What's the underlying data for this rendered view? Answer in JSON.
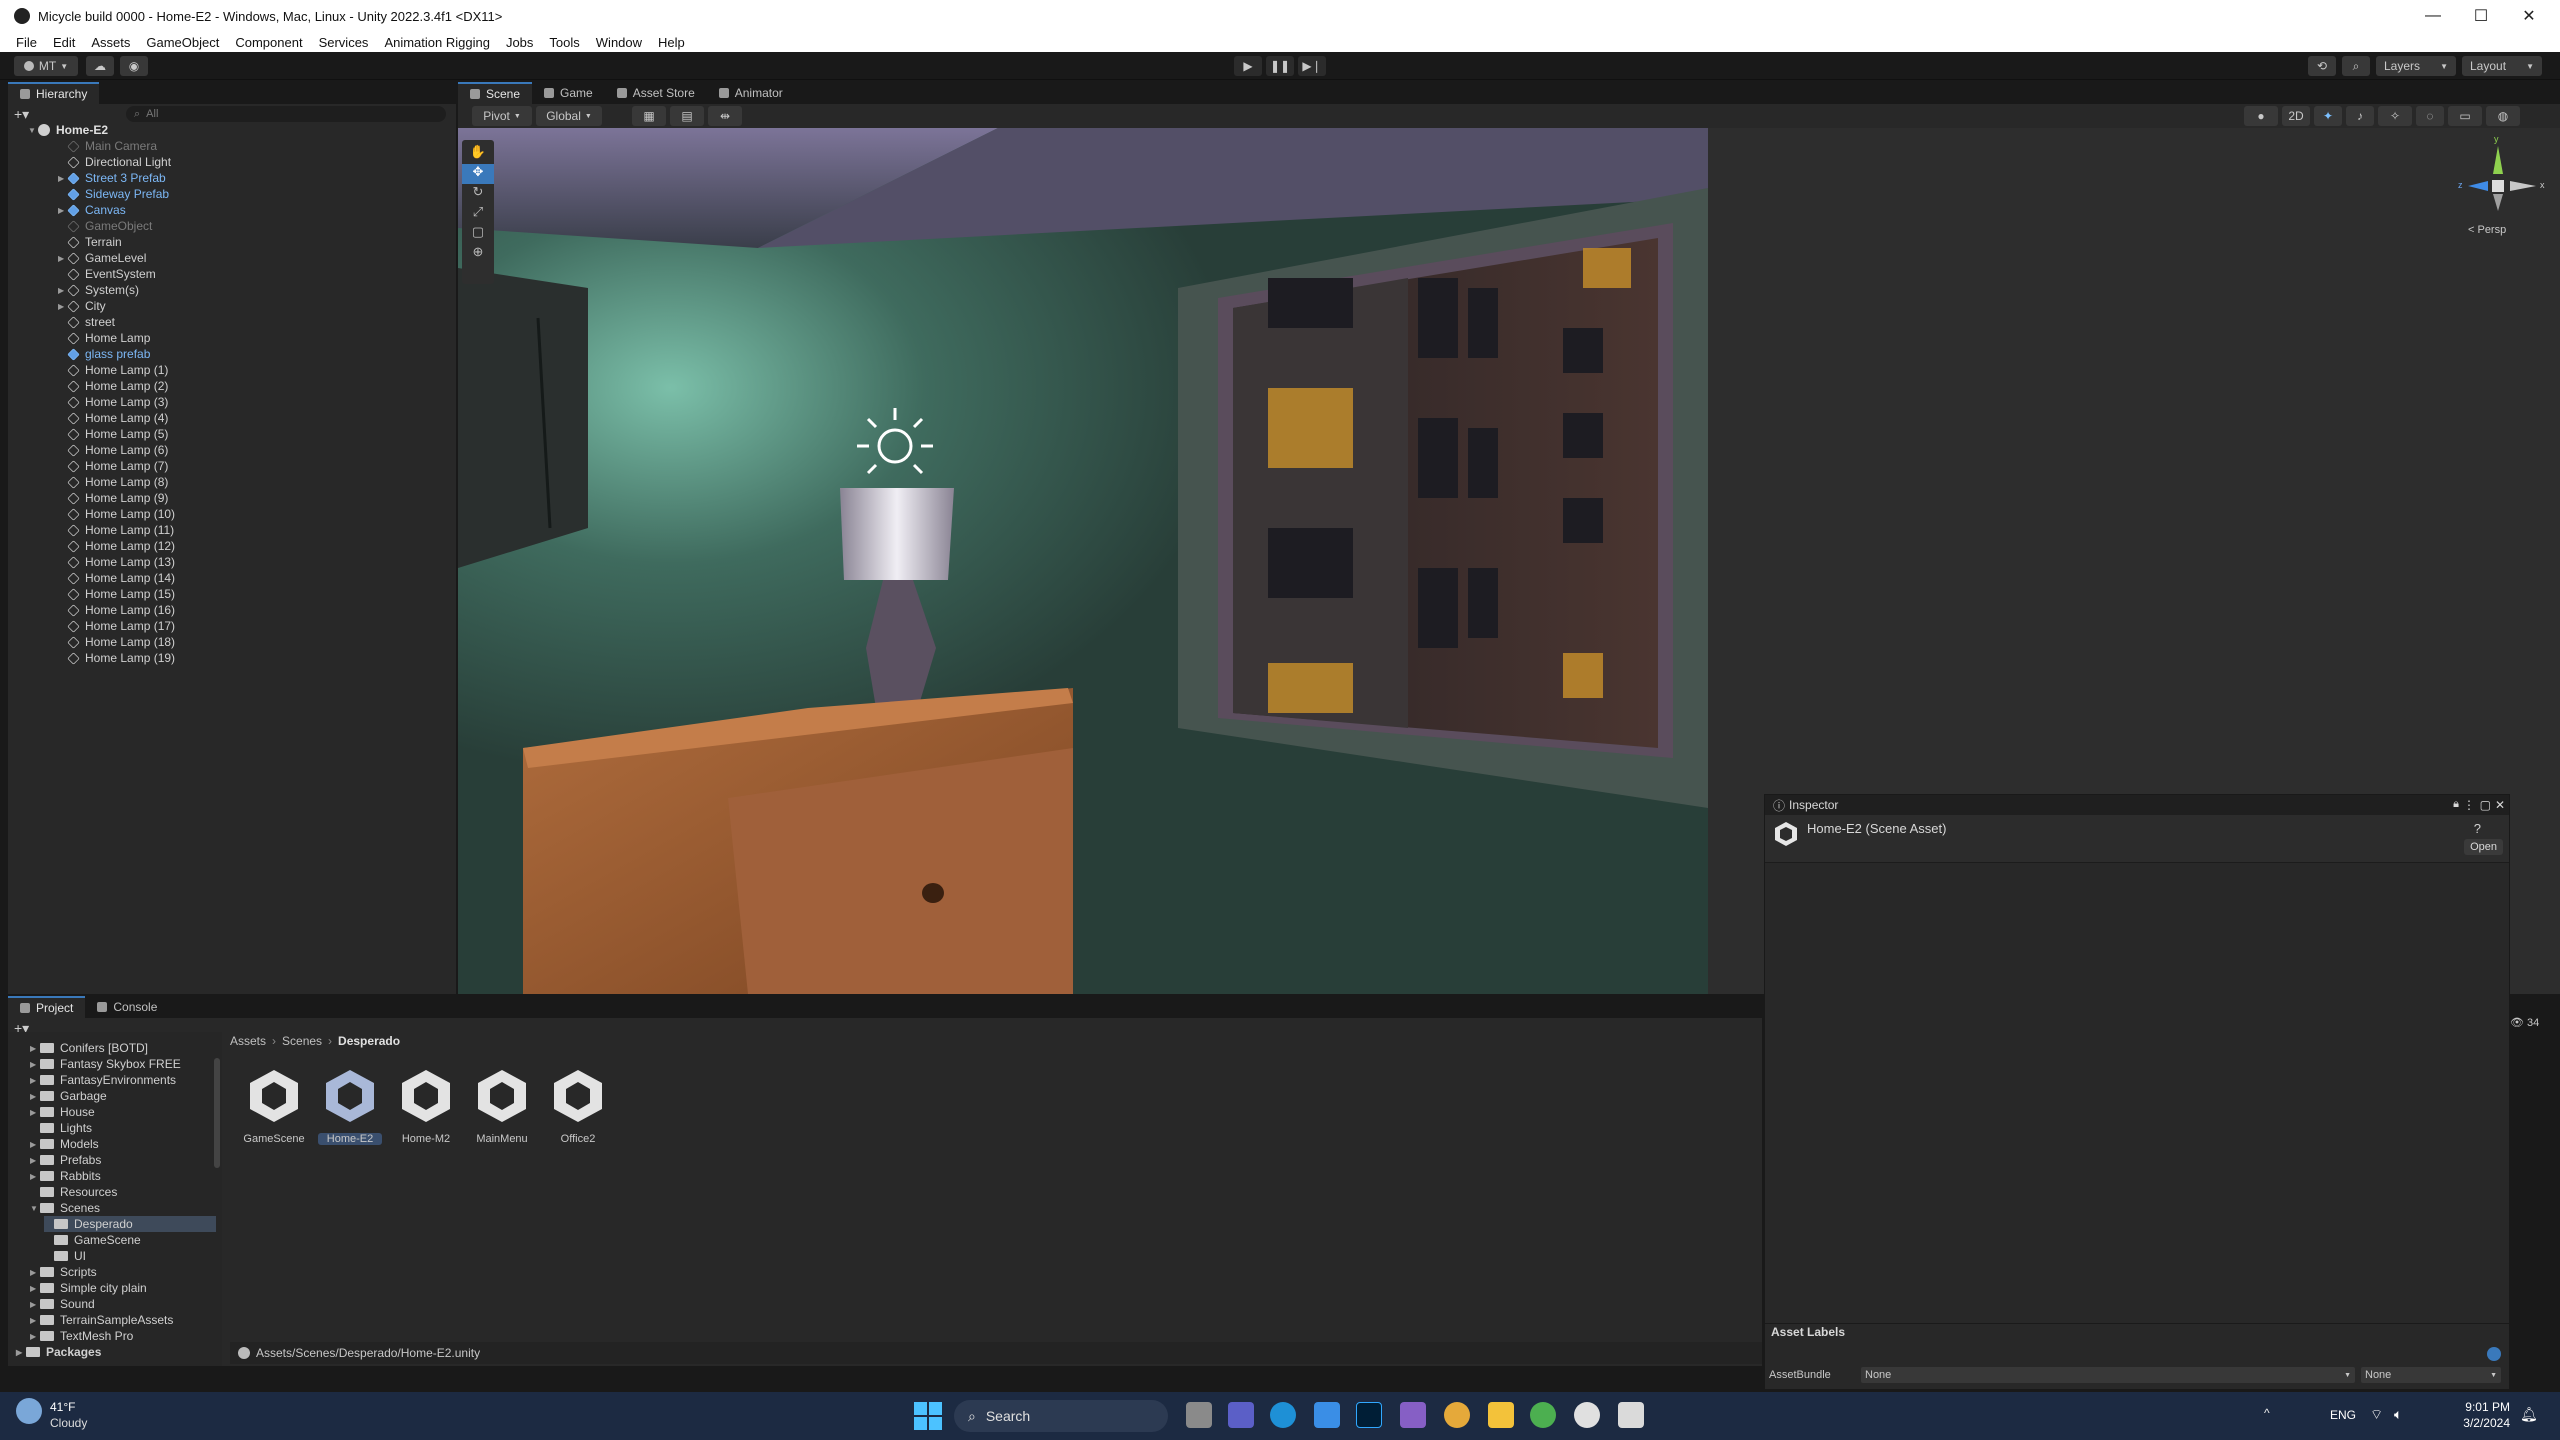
{
  "window": {
    "title": "Micycle build 0000 - Home-E2 - Windows, Mac, Linux - Unity 2022.3.4f1 <DX11>",
    "minimize": "—",
    "maximize": "☐",
    "close": "✕"
  },
  "menu": [
    "File",
    "Edit",
    "Assets",
    "GameObject",
    "Component",
    "Services",
    "Animation Rigging",
    "Jobs",
    "Tools",
    "Window",
    "Help"
  ],
  "toolbar": {
    "account": "MT",
    "layers": "Layers",
    "layout": "Layout"
  },
  "hierarchy": {
    "tab": "Hierarchy",
    "search_placeholder": "All",
    "scene": "Home-E2",
    "items": [
      {
        "label": "Main Camera",
        "kind": "disabled"
      },
      {
        "label": "Directional Light",
        "kind": "normal"
      },
      {
        "label": "Street 3 Prefab",
        "kind": "prefab",
        "expand": true
      },
      {
        "label": "Sideway Prefab",
        "kind": "prefab"
      },
      {
        "label": "Canvas",
        "kind": "prefab",
        "expand": true
      },
      {
        "label": "GameObject",
        "kind": "disabled"
      },
      {
        "label": "Terrain",
        "kind": "normal"
      },
      {
        "label": "GameLevel",
        "kind": "normal",
        "expand": true
      },
      {
        "label": "EventSystem",
        "kind": "normal"
      },
      {
        "label": "System(s)",
        "kind": "normal",
        "expand": true
      },
      {
        "label": "City",
        "kind": "normal",
        "expand": true
      },
      {
        "label": "street",
        "kind": "normal"
      },
      {
        "label": "Home Lamp",
        "kind": "normal"
      },
      {
        "label": "glass prefab",
        "kind": "prefab"
      },
      {
        "label": "Home Lamp (1)",
        "kind": "normal"
      },
      {
        "label": "Home Lamp (2)",
        "kind": "normal"
      },
      {
        "label": "Home Lamp (3)",
        "kind": "normal"
      },
      {
        "label": "Home Lamp (4)",
        "kind": "normal"
      },
      {
        "label": "Home Lamp (5)",
        "kind": "normal"
      },
      {
        "label": "Home Lamp (6)",
        "kind": "normal"
      },
      {
        "label": "Home Lamp (7)",
        "kind": "normal"
      },
      {
        "label": "Home Lamp (8)",
        "kind": "normal"
      },
      {
        "label": "Home Lamp (9)",
        "kind": "normal"
      },
      {
        "label": "Home Lamp (10)",
        "kind": "normal"
      },
      {
        "label": "Home Lamp (11)",
        "kind": "normal"
      },
      {
        "label": "Home Lamp (12)",
        "kind": "normal"
      },
      {
        "label": "Home Lamp (13)",
        "kind": "normal"
      },
      {
        "label": "Home Lamp (14)",
        "kind": "normal"
      },
      {
        "label": "Home Lamp (15)",
        "kind": "normal"
      },
      {
        "label": "Home Lamp (16)",
        "kind": "normal"
      },
      {
        "label": "Home Lamp (17)",
        "kind": "normal"
      },
      {
        "label": "Home Lamp (18)",
        "kind": "normal"
      },
      {
        "label": "Home Lamp (19)",
        "kind": "normal"
      }
    ]
  },
  "scene_view": {
    "tabs": [
      "Scene",
      "Game",
      "Asset Store",
      "Animator"
    ],
    "pivot": "Pivot",
    "global": "Global",
    "mode_2d": "2D",
    "persp": "< Persp",
    "gizmo_axes": [
      "y",
      "z",
      "x"
    ]
  },
  "inspector": {
    "tab": "Inspector",
    "title": "Home-E2 (Scene Asset)",
    "open_button": "Open",
    "asset_labels": "Asset Labels",
    "asset_bundle_label": "AssetBundle",
    "asset_bundle_value": "None",
    "asset_bundle_variant": "None"
  },
  "project": {
    "tabs": [
      "Project",
      "Console"
    ],
    "count": "34",
    "folders": [
      {
        "label": "Conifers [BOTD]",
        "depth": 1,
        "expand": true
      },
      {
        "label": "Fantasy Skybox FREE",
        "depth": 1,
        "expand": true
      },
      {
        "label": "FantasyEnvironments",
        "depth": 1,
        "expand": true
      },
      {
        "label": "Garbage",
        "depth": 1,
        "expand": true
      },
      {
        "label": "House",
        "depth": 1,
        "expand": true
      },
      {
        "label": "Lights",
        "depth": 1
      },
      {
        "label": "Models",
        "depth": 1,
        "expand": true
      },
      {
        "label": "Prefabs",
        "depth": 1,
        "expand": true
      },
      {
        "label": "Rabbits",
        "depth": 1,
        "expand": true
      },
      {
        "label": "Resources",
        "depth": 1
      },
      {
        "label": "Scenes",
        "depth": 1,
        "open": true
      },
      {
        "label": "Desperado",
        "depth": 2,
        "selected": true
      },
      {
        "label": "GameScene",
        "depth": 2
      },
      {
        "label": "UI",
        "depth": 2
      },
      {
        "label": "Scripts",
        "depth": 1,
        "expand": true
      },
      {
        "label": "Simple city plain",
        "depth": 1,
        "expand": true
      },
      {
        "label": "Sound",
        "depth": 1,
        "expand": true
      },
      {
        "label": "TerrainSampleAssets",
        "depth": 1,
        "expand": true
      },
      {
        "label": "TextMesh Pro",
        "depth": 1,
        "expand": true
      },
      {
        "label": "Packages",
        "depth": 0,
        "expand": true
      }
    ],
    "breadcrumb": [
      "Assets",
      "Scenes",
      "Desperado"
    ],
    "assets": [
      "GameScene",
      "Home-E2",
      "Home-M2",
      "MainMenu",
      "Office2"
    ],
    "selected_asset": "Home-E2",
    "path": "Assets/Scenes/Desperado/Home-E2.unity"
  },
  "taskbar": {
    "weather_temp": "41°F",
    "weather_desc": "Cloudy",
    "search": "Search",
    "lang": "ENG",
    "time": "9:01 PM",
    "date": "3/2/2024"
  },
  "colors": {
    "accent": "#3a79bb",
    "prefab": "#7cb7f5",
    "wall": "#3f6b5e",
    "wood": "#9a5a30"
  }
}
